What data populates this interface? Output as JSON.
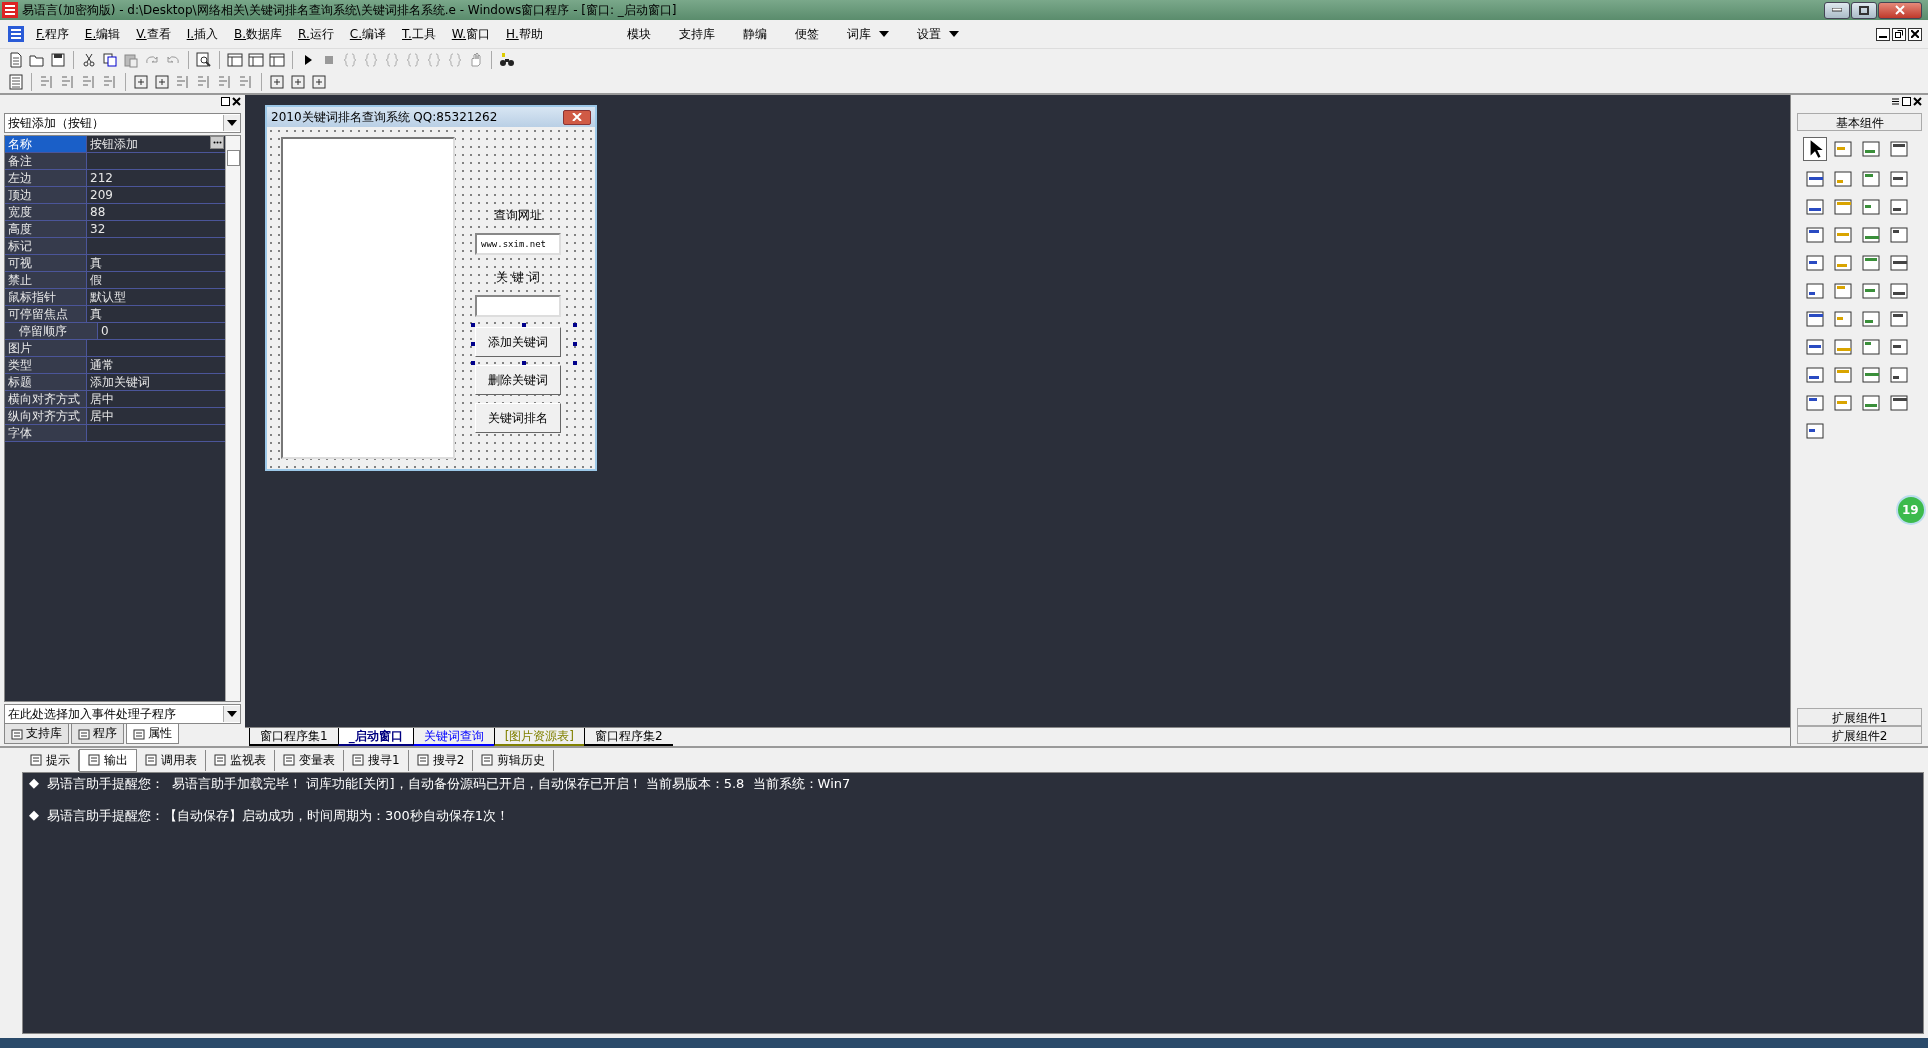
{
  "window": {
    "title": "易语言(加密狗版) - d:\\Desktop\\网络相关\\关键词排名查询系统\\关键词排名系统.e - Windows窗口程序 - [窗口: _启动窗口]"
  },
  "menu": [
    {
      "label": "F.程序"
    },
    {
      "label": "E.编辑"
    },
    {
      "label": "V.查看"
    },
    {
      "label": "I.插入"
    },
    {
      "label": "B.数据库"
    },
    {
      "label": "R.运行"
    },
    {
      "label": "C.编译"
    },
    {
      "label": "T.工具"
    },
    {
      "label": "W.窗口"
    },
    {
      "label": "H.帮助"
    }
  ],
  "menu_right": [
    {
      "label": "模块",
      "dropdown": false
    },
    {
      "label": "支持库",
      "dropdown": false
    },
    {
      "label": "静编",
      "dropdown": false
    },
    {
      "label": "便签",
      "dropdown": false
    },
    {
      "label": "词库",
      "dropdown": true
    },
    {
      "label": "设置",
      "dropdown": true
    }
  ],
  "property_panel": {
    "object": "按钮添加（按钮）",
    "rows": [
      {
        "name": "名称",
        "value": "按钮添加",
        "selected": true
      },
      {
        "name": "备注",
        "selected": false
      },
      {
        "name": "左边",
        "value": "212",
        "selected": false
      },
      {
        "name": "顶边",
        "value": "209",
        "selected": false
      },
      {
        "name": "宽度",
        "value": "88",
        "selected": false
      },
      {
        "name": "高度",
        "value": "32",
        "selected": false
      },
      {
        "name": "标记",
        "selected": false
      },
      {
        "name": "可视",
        "value": "真",
        "selected": false
      },
      {
        "name": "禁止",
        "value": "假",
        "selected": false
      },
      {
        "name": "鼠标指针",
        "value": "默认型",
        "selected": false
      },
      {
        "name": "可停留焦点",
        "value": "真",
        "selected": false,
        "children": [
          {
            "name": "停留顺序",
            "value": "0",
            "selected": false
          }
        ]
      },
      {
        "name": "图片",
        "selected": false
      },
      {
        "name": "类型",
        "value": "通常",
        "selected": false
      },
      {
        "name": "标题",
        "value": "添加关键词",
        "selected": false
      },
      {
        "name": "横向对齐方式",
        "value": "居中",
        "selected": false
      },
      {
        "name": "纵向对齐方式",
        "value": "居中",
        "selected": false
      },
      {
        "name": "字体",
        "selected": false
      }
    ],
    "event_selector": "在此处选择加入事件处理子程序",
    "tabs": [
      {
        "label": "支持库",
        "selected": false
      },
      {
        "label": "程序",
        "selected": false
      },
      {
        "label": "属性",
        "selected": true
      }
    ]
  },
  "designer": {
    "title": "2010关键词排名查询系统 QQ:85321262",
    "controls": [
      {
        "kind": "label",
        "text": "查询网址"
      },
      {
        "kind": "input",
        "value": "www.sxim.net"
      },
      {
        "kind": "label",
        "text": "关 键 词"
      },
      {
        "kind": "input"
      },
      {
        "kind": "button",
        "text": "添加关键词",
        "selected": true
      },
      {
        "kind": "button",
        "text": "删除关键词",
        "selected": false
      },
      {
        "kind": "button",
        "text": "关键词排名",
        "selected": false
      }
    ]
  },
  "document_tabs": [
    {
      "label": "窗口程序集1",
      "selected": false,
      "color": "#000000"
    },
    {
      "label": "_启动窗口",
      "selected": true,
      "color": "#000080"
    },
    {
      "label": "关键词查询",
      "selected": false,
      "color": "#0000ff"
    },
    {
      "label": "[图片资源表]",
      "selected": false,
      "color": "#808000"
    },
    {
      "label": "窗口程序集2",
      "selected": false,
      "color": "#000000"
    }
  ],
  "toolbox": {
    "title": "基本组件",
    "groups": [
      "扩展组件1",
      "扩展组件2"
    ]
  },
  "badge": "19",
  "output_tabs": [
    {
      "label": "提示",
      "selected": false
    },
    {
      "label": "输出",
      "selected": true
    },
    {
      "label": "调用表",
      "selected": false
    },
    {
      "label": "监视表",
      "selected": false
    },
    {
      "label": "变量表",
      "selected": false
    },
    {
      "label": "搜寻1",
      "selected": false
    },
    {
      "label": "搜寻2",
      "selected": false
    },
    {
      "label": "剪辑历史",
      "selected": false
    }
  ],
  "output_lines": [
    {
      "bullet": "◆",
      "text": "易语言助手提醒您：  易语言助手加载完毕！ 词库功能[关闭]，自动备份源码已开启，自动保存已开启！ 当前易版本：5.8  当前系统：Win7"
    },
    {
      "bullet": "◆",
      "text": "易语言助手提醒您：【自动保存】启动成功，时间周期为：300秒自动保存1次！"
    }
  ]
}
